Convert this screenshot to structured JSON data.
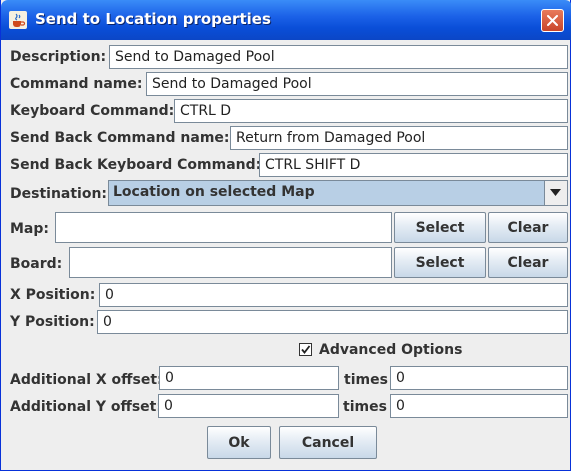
{
  "window": {
    "title": "Send to Location properties"
  },
  "fields": {
    "description": {
      "label": "Description:",
      "value": "Send to Damaged Pool"
    },
    "command_name": {
      "label": "Command name:",
      "value": "Send to Damaged Pool"
    },
    "keyboard_command": {
      "label": "Keyboard Command:",
      "value": "CTRL D"
    },
    "send_back_command_name": {
      "label": "Send Back Command name:",
      "value": "Return from Damaged Pool"
    },
    "send_back_keyboard_command": {
      "label": "Send Back Keyboard Command:",
      "value": "CTRL SHIFT D"
    },
    "destination": {
      "label": "Destination:",
      "value": "Location on selected Map"
    },
    "map": {
      "label": "Map:",
      "value": ""
    },
    "board": {
      "label": "Board:",
      "value": ""
    },
    "x_position": {
      "label": "X Position:",
      "value": "0"
    },
    "y_position": {
      "label": "Y Position:",
      "value": "0"
    },
    "additional_x_offset": {
      "label": "Additional X offset:",
      "value": "0",
      "times_label": "times",
      "times_value": "0"
    },
    "additional_y_offset": {
      "label": "Additional Y offset:",
      "value": "0",
      "times_label": "times",
      "times_value": "0"
    }
  },
  "buttons": {
    "select": "Select",
    "clear": "Clear",
    "ok": "Ok",
    "cancel": "Cancel"
  },
  "advanced_options": {
    "label": "Advanced Options",
    "checked": true
  },
  "icons": {
    "app": "java-coffee-cup-icon",
    "close": "close-icon",
    "dropdown": "chevron-down-icon",
    "check": "checkmark-icon"
  },
  "colors": {
    "title_bar": "#0a4ed8",
    "close_button": "#c9452a",
    "dialog_bg": "#eeeeee",
    "dropdown_selected": "#b8cfe5"
  }
}
